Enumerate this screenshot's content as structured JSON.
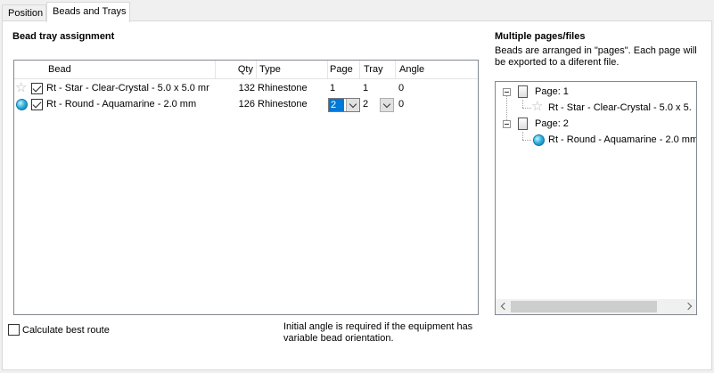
{
  "tabs": [
    {
      "label": "Position",
      "active": false
    },
    {
      "label": "Beads and Trays",
      "active": true
    }
  ],
  "bead_tray": {
    "heading": "Bead tray assignment",
    "columns": [
      "Bead",
      "Qty",
      "Type",
      "Page",
      "Tray",
      "Angle"
    ],
    "rows": [
      {
        "icon": "star-icon",
        "checked": true,
        "bead": "Rt - Star - Clear-Crystal - 5.0 x  5.0 mr",
        "qty": "132",
        "type": "Rhinestone",
        "page": "1",
        "tray": "1",
        "angle": "0"
      },
      {
        "icon": "gem-icon",
        "checked": true,
        "bead": "Rt - Round - Aquamarine - 2.0 mm",
        "qty": "126",
        "type": "Rhinestone",
        "page": "2",
        "tray": "2",
        "angle": "0"
      }
    ]
  },
  "multi_pages": {
    "heading": "Multiple pages/files",
    "description": "Beads are arranged in \"pages\". Each page will be exported to a diferent file.",
    "tree": [
      {
        "label": "Page: 1",
        "children": [
          {
            "icon": "star-icon",
            "label": "Rt - Star - Clear-Crystal - 5.0 x  5."
          }
        ]
      },
      {
        "label": "Page: 2",
        "children": [
          {
            "icon": "gem-icon",
            "label": "Rt - Round - Aquamarine - 2.0 mm"
          }
        ]
      }
    ]
  },
  "calculate_best_route": {
    "label": "Calculate best route",
    "checked": false
  },
  "angle_note": "Initial angle is required if the equipment has variable bead orientation."
}
